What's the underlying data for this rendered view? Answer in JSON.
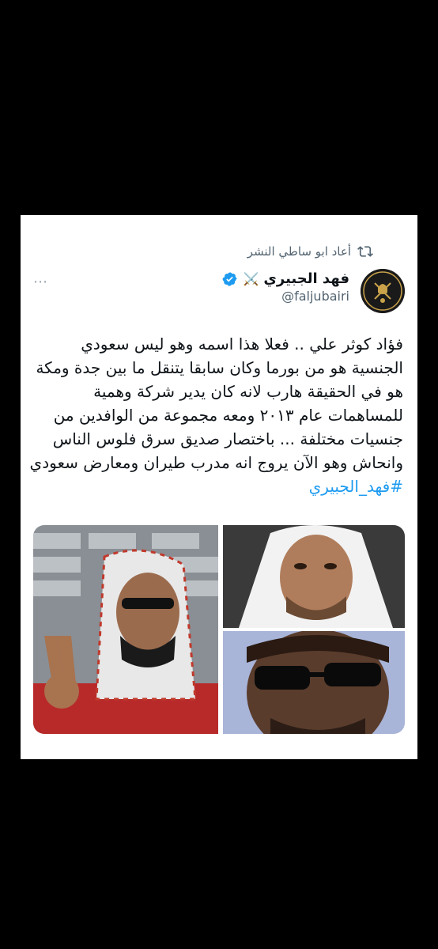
{
  "retweet": {
    "label": "أعاد ابو ساطي النشر"
  },
  "author": {
    "name": "فهد الجبيري",
    "badge": "⚔️",
    "handle": "@faljubairi"
  },
  "more_label": "⋯",
  "tweet": {
    "lines": [
      "فؤاد كوثر علي .. فعلا هذا اسمه وهو ليس سعودي",
      "الجنسية هو من بورما وكان سابقا يتنقل ما بين جدة ومكة",
      "هو في الحقيقة هارب لانه كان يدير شركة وهمية",
      "للمساهمات عام ٢٠١٣ ومعه مجموعة من الوافدين من",
      "جنسيات مختلفة  ... باختصار صديق سرق فلوس الناس",
      "وانحاش وهو الآن يروج انه مدرب طيران ومعارض سعودي"
    ],
    "hashtag": "#فهد_الجبيري"
  },
  "colors": {
    "accent": "#1d9bf0",
    "text": "#0f1419",
    "muted": "#536471"
  }
}
